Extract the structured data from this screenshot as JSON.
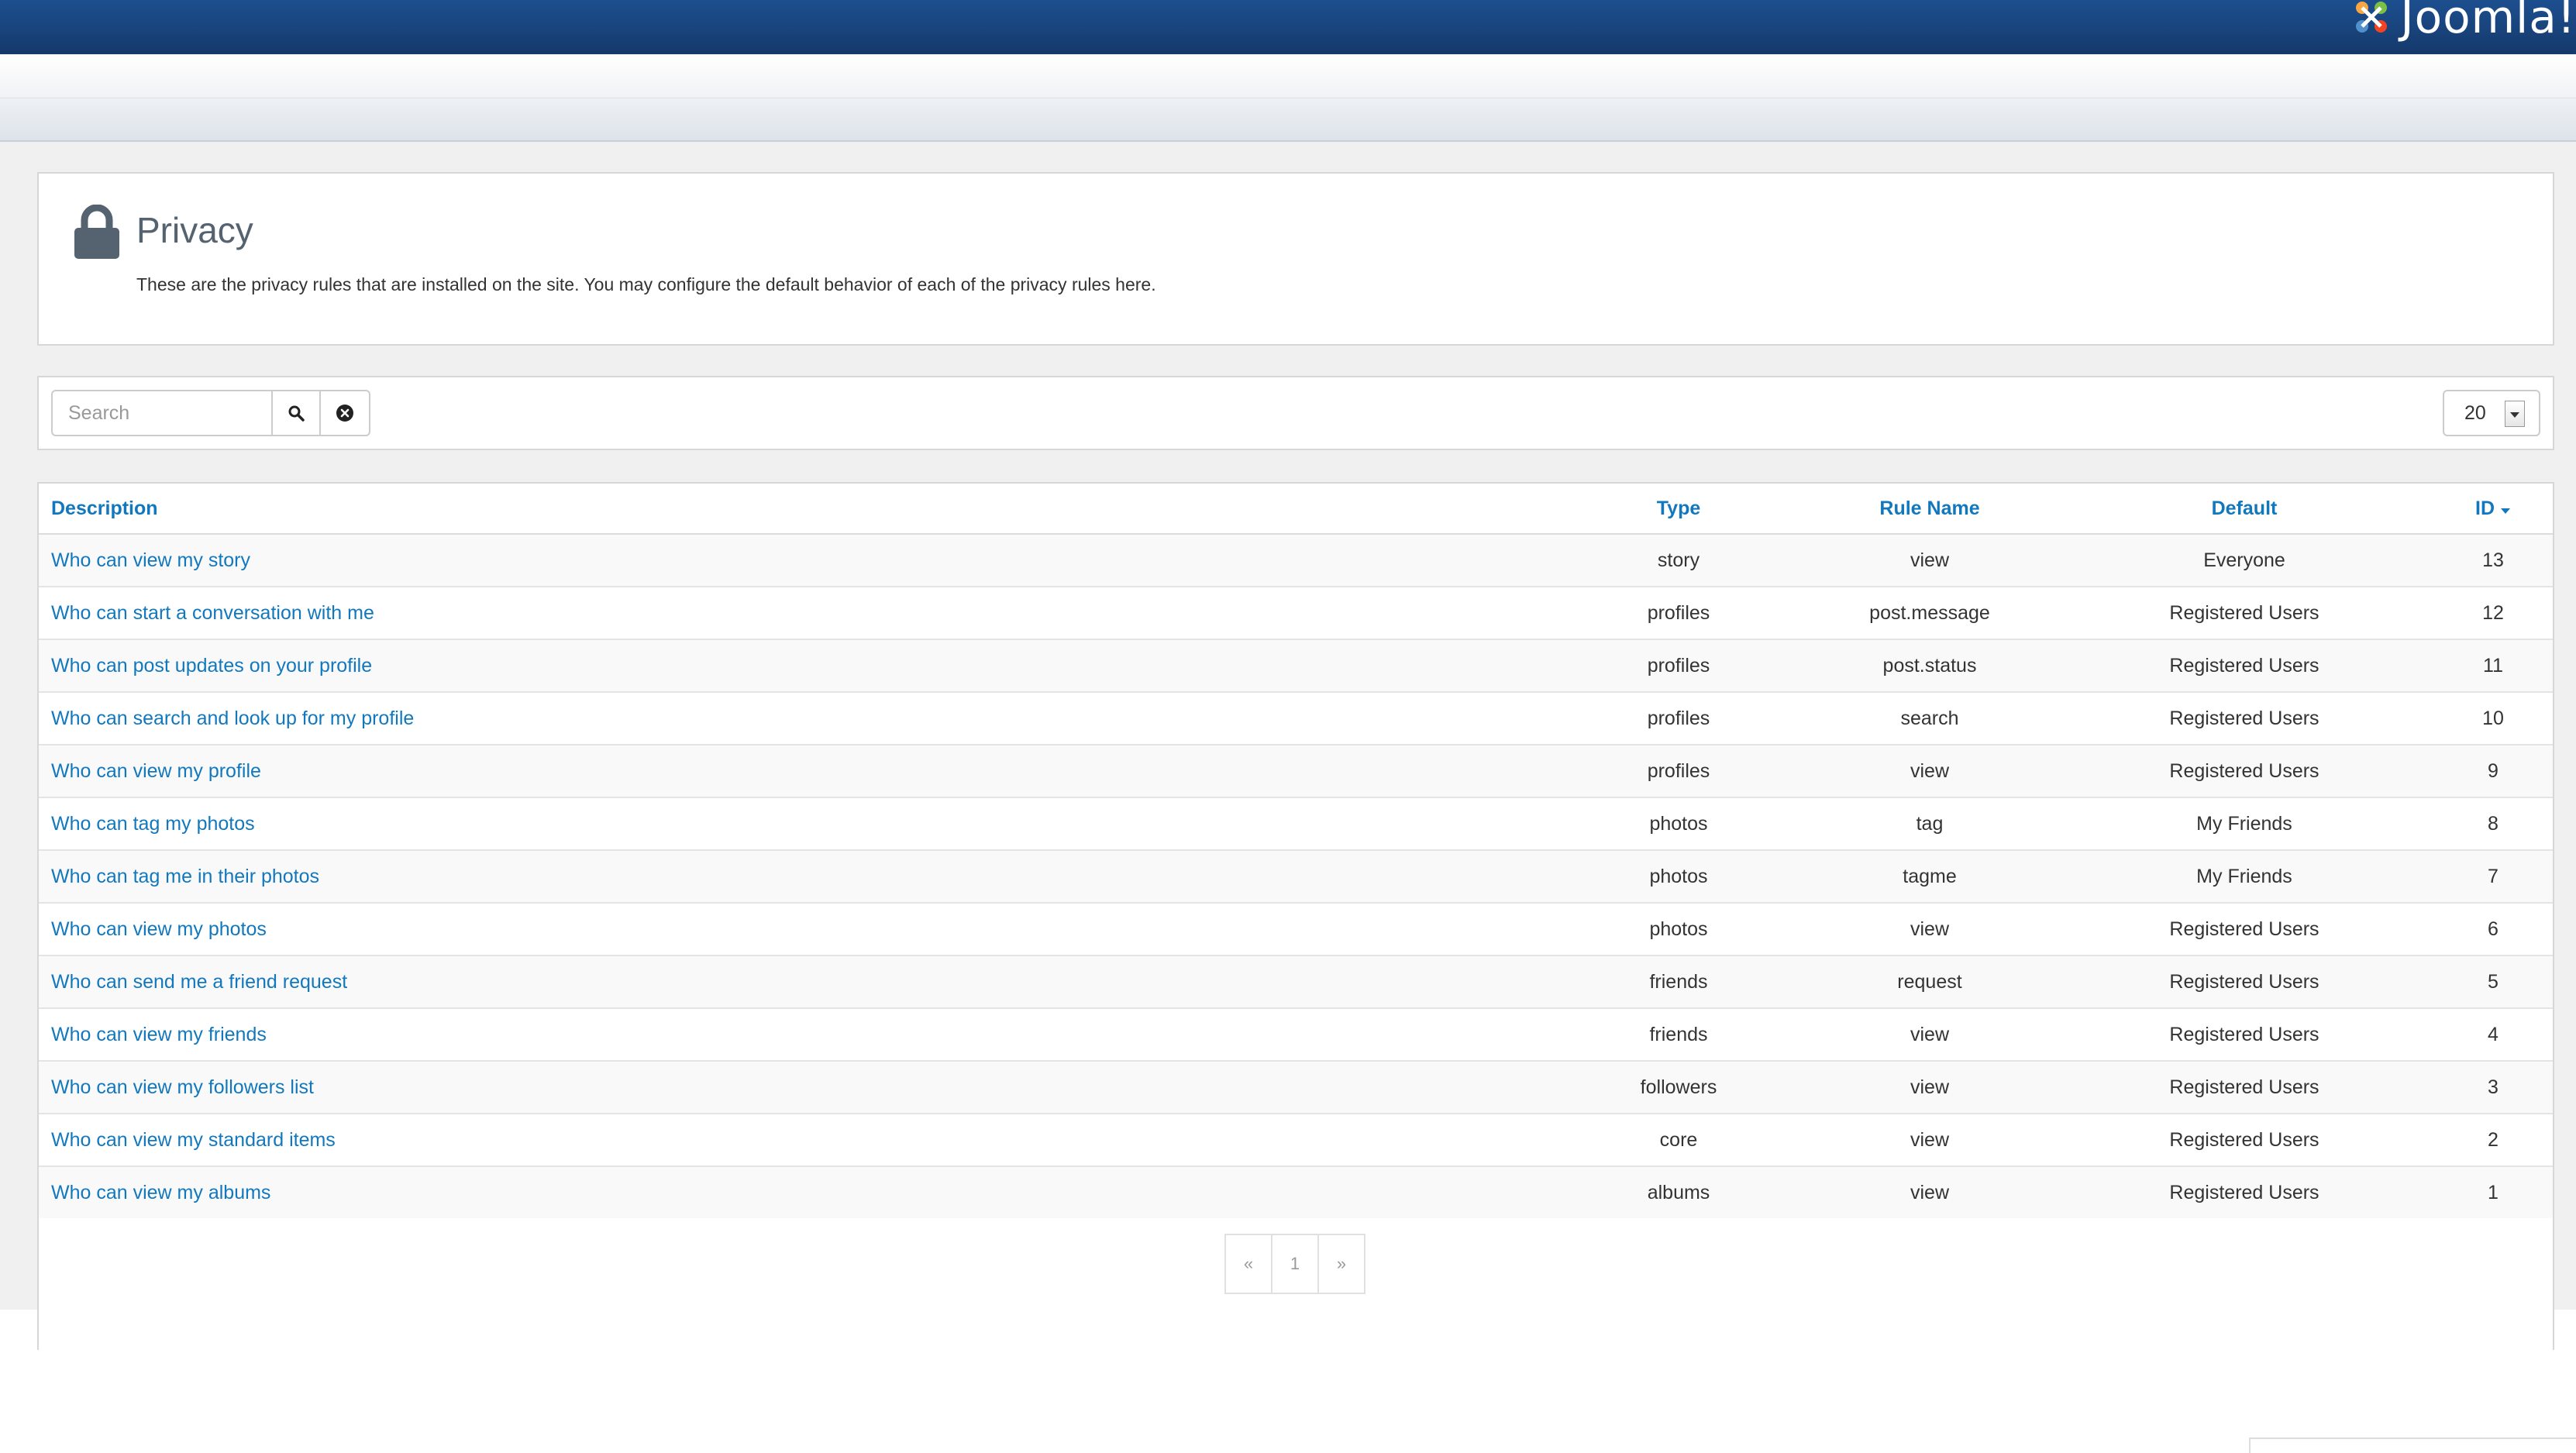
{
  "brand": {
    "name": "Joomla!"
  },
  "page": {
    "title": "Privacy",
    "description": "These are the privacy rules that are installed on the site. You may configure the default behavior of each of the privacy rules here."
  },
  "filter": {
    "search_placeholder": "Search",
    "search_icon": "search-icon",
    "clear_icon": "clear-icon",
    "limit_value": "20"
  },
  "table": {
    "columns": {
      "description": "Description",
      "type": "Type",
      "rule_name": "Rule Name",
      "default": "Default",
      "id": "ID"
    },
    "sort_column": "id",
    "rows": [
      {
        "description": "Who can view my story",
        "type": "story",
        "rule_name": "view",
        "default": "Everyone",
        "id": "13"
      },
      {
        "description": "Who can start a conversation with me",
        "type": "profiles",
        "rule_name": "post.message",
        "default": "Registered Users",
        "id": "12"
      },
      {
        "description": "Who can post updates on your profile",
        "type": "profiles",
        "rule_name": "post.status",
        "default": "Registered Users",
        "id": "11"
      },
      {
        "description": "Who can search and look up for my profile",
        "type": "profiles",
        "rule_name": "search",
        "default": "Registered Users",
        "id": "10"
      },
      {
        "description": "Who can view my profile",
        "type": "profiles",
        "rule_name": "view",
        "default": "Registered Users",
        "id": "9"
      },
      {
        "description": "Who can tag my photos",
        "type": "photos",
        "rule_name": "tag",
        "default": "My Friends",
        "id": "8"
      },
      {
        "description": "Who can tag me in their photos",
        "type": "photos",
        "rule_name": "tagme",
        "default": "My Friends",
        "id": "7"
      },
      {
        "description": "Who can view my photos",
        "type": "photos",
        "rule_name": "view",
        "default": "Registered Users",
        "id": "6"
      },
      {
        "description": "Who can send me a friend request",
        "type": "friends",
        "rule_name": "request",
        "default": "Registered Users",
        "id": "5"
      },
      {
        "description": "Who can view my friends",
        "type": "friends",
        "rule_name": "view",
        "default": "Registered Users",
        "id": "4"
      },
      {
        "description": "Who can view my followers list",
        "type": "followers",
        "rule_name": "view",
        "default": "Registered Users",
        "id": "3"
      },
      {
        "description": "Who can view my standard items",
        "type": "core",
        "rule_name": "view",
        "default": "Registered Users",
        "id": "2"
      },
      {
        "description": "Who can view my albums",
        "type": "albums",
        "rule_name": "view",
        "default": "Registered Users",
        "id": "1"
      }
    ]
  },
  "pagination": {
    "prev": "«",
    "current": "1",
    "next": "»"
  },
  "colors": {
    "topbar": "#1a4480",
    "link": "#1278be",
    "title": "#556270"
  }
}
